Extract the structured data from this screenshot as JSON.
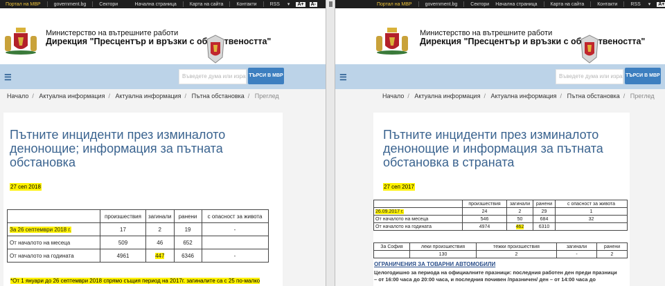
{
  "topbar": {
    "portal": "Портал на МВР",
    "gov": "government.bg",
    "sectors": "Сектори",
    "home": "Начална страница",
    "sitemap": "Карта на сайта",
    "contacts": "Контакти",
    "rss": "RSS",
    "font_plus": "A+",
    "font_minus": "A-"
  },
  "header": {
    "ministry_line": "Министерство на вътрешните работи",
    "directorate_line": "Дирекция \"Пресцентър и връзки с обществеността\""
  },
  "nav": {
    "search_placeholder": "Въведете дума или израз",
    "search_button": "ТЪРСИ В МВР"
  },
  "breadcrumbs": [
    "Начало",
    "Актуална информация",
    "Актуална информация",
    "Пътна обстановка",
    "Преглед"
  ],
  "left": {
    "title": "Пътните инциденти през изминалото денонощие; информация за пътната обстановка",
    "date": "27 сеп 2018",
    "table": {
      "headers": [
        "",
        "произшествия",
        "загинали",
        "ранени",
        "с опасност за живота"
      ],
      "rows": [
        [
          "За 26 септември 2018 г.",
          "17",
          "2",
          "19",
          "-"
        ],
        [
          "От началото на месеца",
          "509",
          "46",
          "652",
          ""
        ],
        [
          "От началото на годината",
          "4961",
          "447",
          "6346",
          "-"
        ]
      ]
    },
    "note": "*От 1 януари до 26 септември 2018 спрямо същия период на 2017г. загиналите са с 25 по-малко"
  },
  "right": {
    "title": "Пътните инциденти през изминалото денонощие и информация за пътната обстановка в страната",
    "date": "27 сеп 2017",
    "table": {
      "headers": [
        "",
        "произшествия",
        "загинали",
        "ранени",
        "с опасност за живота"
      ],
      "rows": [
        [
          "26.09.2017 г.",
          "24",
          "2",
          "29",
          "1"
        ],
        [
          "От началото на месеца",
          "546",
          "50",
          "684",
          "32"
        ],
        [
          "От началото на годината",
          "4974",
          "462",
          "6310",
          ""
        ]
      ]
    },
    "sofia_table": {
      "headers": [
        "За София",
        "леки произшествия",
        "тежки произшествия",
        "загинали",
        "ранени"
      ],
      "row": [
        "",
        "130",
        "2",
        "-",
        "2"
      ]
    },
    "restrictions_heading": "ОГРАНИЧЕНИЯ ЗА ТОВАРНИ АВТОМОБИЛИ",
    "restrictions_line1": "Целогодишно за периода на официалните празници: последния работен ден преди празници",
    "restrictions_line2": "– от 16:00 часа до 20:00 часа, и последния почивен /празничен/ ден – от 14:00 часа до"
  },
  "colors": {
    "title_blue": "#3a638f",
    "nav_bg": "#bcd3e8",
    "button_blue": "#3d7fc0",
    "highlight": "#fff200"
  }
}
